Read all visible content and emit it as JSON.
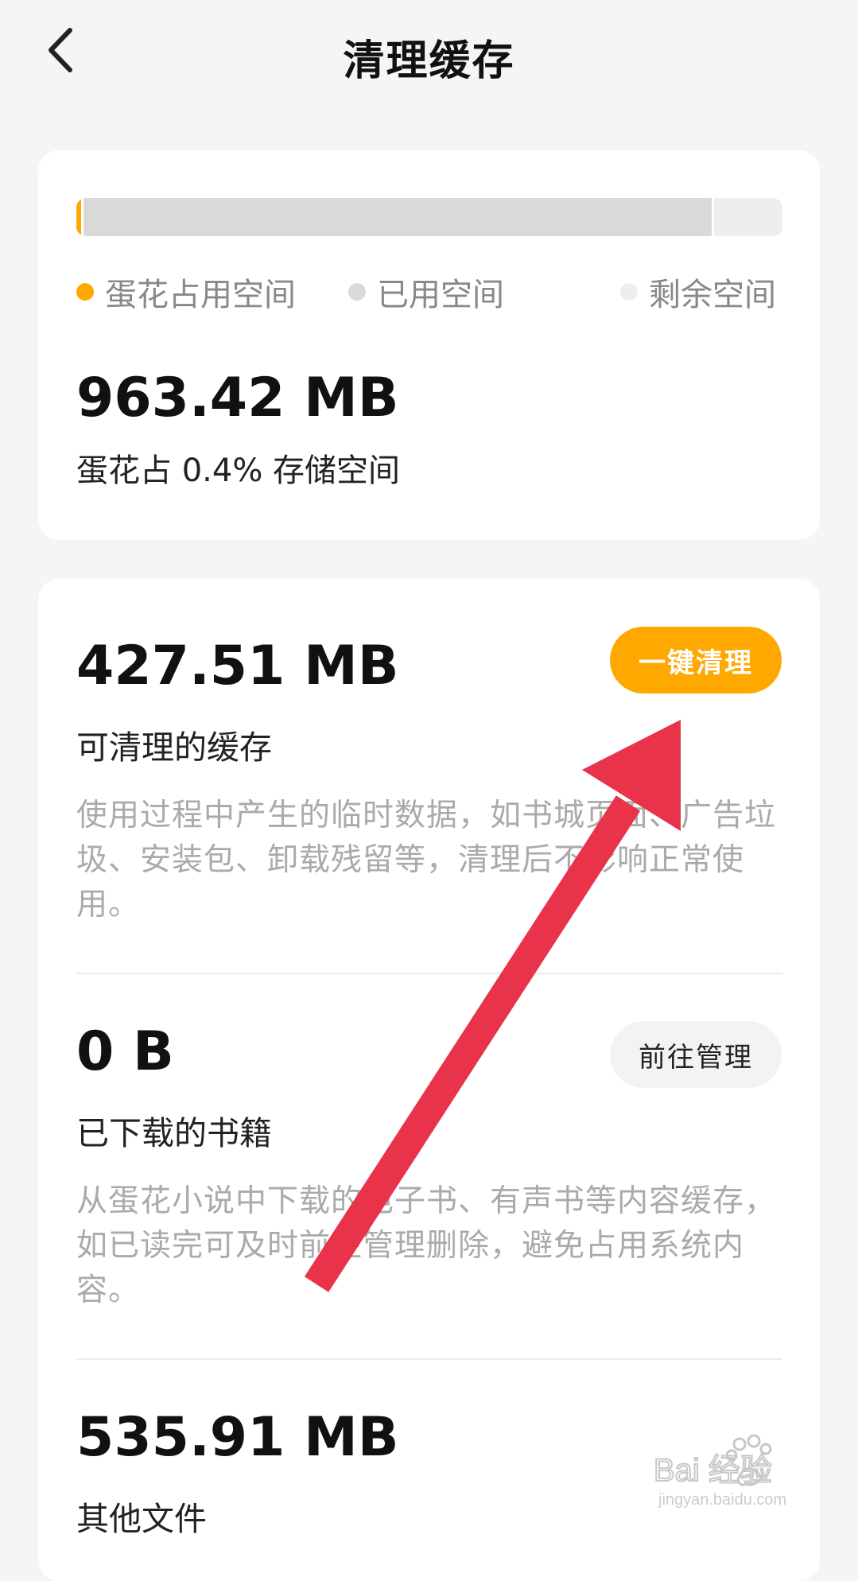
{
  "header": {
    "title": "清理缓存",
    "back_icon": "chevron-left-icon"
  },
  "storage": {
    "bar": {
      "app_fraction": 0.004,
      "used_fraction": 0.9,
      "colors": {
        "app": "#ffa800",
        "used": "#d9d9d9",
        "free": "#eeeeee"
      }
    },
    "legend": [
      {
        "label": "蛋花占用空间",
        "color": "#ffa800"
      },
      {
        "label": "已用空间",
        "color": "#d9d9d9"
      },
      {
        "label": "剩余空间",
        "color": "#eeeeee"
      }
    ],
    "total_size": "963.42 MB",
    "description": "蛋花占 0.4% 存储空间"
  },
  "items": [
    {
      "size": "427.51 MB",
      "label": "可清理的缓存",
      "description": "使用过程中产生的临时数据，如书城页面、广告垃圾、安装包、卸载残留等，清理后不影响正常使用。",
      "button": "一键清理"
    },
    {
      "size": "0 B",
      "label": "已下载的书籍",
      "description": "从蛋花小说中下载的电子书、有声书等内容缓存，如已读完可及时前往管理删除，避免占用系统内容。",
      "button": "前往管理"
    },
    {
      "size": "535.91 MB",
      "label": "其他文件"
    }
  ],
  "overlay": {
    "arrow_color": "#e8334a",
    "watermark": {
      "brand": "Bai 经验",
      "url": "jingyan.baidu.com"
    }
  },
  "theme": {
    "accent": "#ffa800",
    "background": "#f5f5f5"
  }
}
